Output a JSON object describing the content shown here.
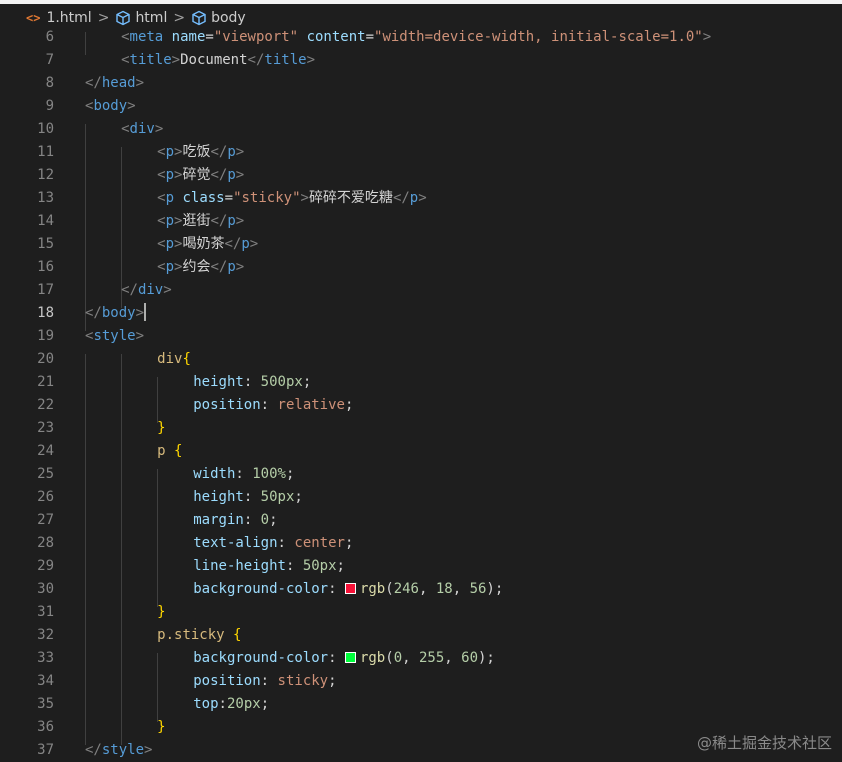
{
  "breadcrumb": {
    "file_icon": "<>",
    "file": "1.html",
    "item1": "html",
    "item2": "body",
    "separator": ">",
    "cube_icon": "symbol-structure-icon"
  },
  "colors": {
    "editor_bg": "#1e1e1e",
    "swatch_red": "rgb(246, 18, 56)",
    "swatch_green": "rgb(0, 255, 60)"
  },
  "editor": {
    "active_line": "18",
    "lines": [
      {
        "n": "6",
        "tokens": [
          [
            "tag-br",
            "<"
          ],
          [
            "tag",
            "meta"
          ],
          [
            "sp",
            " "
          ],
          [
            "attr",
            "name"
          ],
          [
            "punc",
            "="
          ],
          [
            "str",
            "\"viewport\""
          ],
          [
            "sp",
            " "
          ],
          [
            "attr",
            "content"
          ],
          [
            "punc",
            "="
          ],
          [
            "str",
            "\"width=device-width, initial-scale=1.0\""
          ],
          [
            "tag-br",
            ">"
          ]
        ]
      },
      {
        "n": "7",
        "tokens": [
          [
            "tag-br",
            "<"
          ],
          [
            "tag",
            "title"
          ],
          [
            "tag-br",
            ">"
          ],
          [
            "text",
            "Document"
          ],
          [
            "tag-br",
            "</"
          ],
          [
            "tag",
            "title"
          ],
          [
            "tag-br",
            ">"
          ]
        ]
      },
      {
        "n": "8",
        "tokens": [
          [
            "tag-br",
            "</"
          ],
          [
            "tag",
            "head"
          ],
          [
            "tag-br",
            ">"
          ]
        ]
      },
      {
        "n": "9",
        "tokens": [
          [
            "tag-br",
            "<"
          ],
          [
            "tag",
            "body"
          ],
          [
            "tag-br",
            ">"
          ]
        ]
      },
      {
        "n": "10",
        "tokens": [
          [
            "tag-br",
            "<"
          ],
          [
            "tag",
            "div"
          ],
          [
            "tag-br",
            ">"
          ]
        ]
      },
      {
        "n": "11",
        "tokens": [
          [
            "tag-br",
            "<"
          ],
          [
            "tag",
            "p"
          ],
          [
            "tag-br",
            ">"
          ],
          [
            "text",
            "吃饭"
          ],
          [
            "tag-br",
            "</"
          ],
          [
            "tag",
            "p"
          ],
          [
            "tag-br",
            ">"
          ]
        ]
      },
      {
        "n": "12",
        "tokens": [
          [
            "tag-br",
            "<"
          ],
          [
            "tag",
            "p"
          ],
          [
            "tag-br",
            ">"
          ],
          [
            "text",
            "碎觉"
          ],
          [
            "tag-br",
            "</"
          ],
          [
            "tag",
            "p"
          ],
          [
            "tag-br",
            ">"
          ]
        ]
      },
      {
        "n": "13",
        "tokens": [
          [
            "tag-br",
            "<"
          ],
          [
            "tag",
            "p"
          ],
          [
            "sp",
            " "
          ],
          [
            "attr",
            "class"
          ],
          [
            "punc",
            "="
          ],
          [
            "str",
            "\"sticky\""
          ],
          [
            "tag-br",
            ">"
          ],
          [
            "text",
            "碎碎不爱吃糖"
          ],
          [
            "tag-br",
            "</"
          ],
          [
            "tag",
            "p"
          ],
          [
            "tag-br",
            ">"
          ]
        ]
      },
      {
        "n": "14",
        "tokens": [
          [
            "tag-br",
            "<"
          ],
          [
            "tag",
            "p"
          ],
          [
            "tag-br",
            ">"
          ],
          [
            "text",
            "逛街"
          ],
          [
            "tag-br",
            "</"
          ],
          [
            "tag",
            "p"
          ],
          [
            "tag-br",
            ">"
          ]
        ]
      },
      {
        "n": "15",
        "tokens": [
          [
            "tag-br",
            "<"
          ],
          [
            "tag",
            "p"
          ],
          [
            "tag-br",
            ">"
          ],
          [
            "text",
            "喝奶茶"
          ],
          [
            "tag-br",
            "</"
          ],
          [
            "tag",
            "p"
          ],
          [
            "tag-br",
            ">"
          ]
        ]
      },
      {
        "n": "16",
        "tokens": [
          [
            "tag-br",
            "<"
          ],
          [
            "tag",
            "p"
          ],
          [
            "tag-br",
            ">"
          ],
          [
            "text",
            "约会"
          ],
          [
            "tag-br",
            "</"
          ],
          [
            "tag",
            "p"
          ],
          [
            "tag-br",
            ">"
          ]
        ]
      },
      {
        "n": "17",
        "tokens": [
          [
            "tag-br",
            "</"
          ],
          [
            "tag",
            "div"
          ],
          [
            "tag-br",
            ">"
          ]
        ]
      },
      {
        "n": "18",
        "tokens": [
          [
            "tag-br",
            "</"
          ],
          [
            "tag",
            "body"
          ],
          [
            "tag-br",
            ">"
          ],
          [
            "cursor",
            ""
          ]
        ]
      },
      {
        "n": "19",
        "tokens": [
          [
            "tag-br",
            "<"
          ],
          [
            "tag",
            "style"
          ],
          [
            "tag-br",
            ">"
          ]
        ]
      },
      {
        "n": "20",
        "tokens": [
          [
            "sel",
            "div"
          ],
          [
            "brace",
            "{"
          ]
        ]
      },
      {
        "n": "21",
        "tokens": [
          [
            "prop",
            "height"
          ],
          [
            "punc",
            ": "
          ],
          [
            "num",
            "500px"
          ],
          [
            "punc",
            ";"
          ]
        ]
      },
      {
        "n": "22",
        "tokens": [
          [
            "prop",
            "position"
          ],
          [
            "punc",
            ": "
          ],
          [
            "val",
            "relative"
          ],
          [
            "punc",
            ";"
          ]
        ]
      },
      {
        "n": "23",
        "tokens": [
          [
            "brace",
            "}"
          ]
        ]
      },
      {
        "n": "24",
        "tokens": [
          [
            "sel",
            "p"
          ],
          [
            "sp",
            " "
          ],
          [
            "brace",
            "{"
          ]
        ]
      },
      {
        "n": "25",
        "tokens": [
          [
            "prop",
            "width"
          ],
          [
            "punc",
            ": "
          ],
          [
            "num",
            "100%"
          ],
          [
            "punc",
            ";"
          ]
        ]
      },
      {
        "n": "26",
        "tokens": [
          [
            "prop",
            "height"
          ],
          [
            "punc",
            ": "
          ],
          [
            "num",
            "50px"
          ],
          [
            "punc",
            ";"
          ]
        ]
      },
      {
        "n": "27",
        "tokens": [
          [
            "prop",
            "margin"
          ],
          [
            "punc",
            ": "
          ],
          [
            "num",
            "0"
          ],
          [
            "punc",
            ";"
          ]
        ]
      },
      {
        "n": "28",
        "tokens": [
          [
            "prop",
            "text-align"
          ],
          [
            "punc",
            ": "
          ],
          [
            "val",
            "center"
          ],
          [
            "punc",
            ";"
          ]
        ]
      },
      {
        "n": "29",
        "tokens": [
          [
            "prop",
            "line-height"
          ],
          [
            "punc",
            ": "
          ],
          [
            "num",
            "50px"
          ],
          [
            "punc",
            ";"
          ]
        ]
      },
      {
        "n": "30",
        "tokens": [
          [
            "prop",
            "background-color"
          ],
          [
            "punc",
            ": "
          ],
          [
            "swatch",
            "#f61238"
          ],
          [
            "fn",
            "rgb"
          ],
          [
            "punc",
            "("
          ],
          [
            "num",
            "246"
          ],
          [
            "punc",
            ", "
          ],
          [
            "num",
            "18"
          ],
          [
            "punc",
            ", "
          ],
          [
            "num",
            "56"
          ],
          [
            "punc",
            ");"
          ]
        ]
      },
      {
        "n": "31",
        "tokens": [
          [
            "brace",
            "}"
          ]
        ]
      },
      {
        "n": "32",
        "tokens": [
          [
            "sel",
            "p.sticky"
          ],
          [
            "sp",
            " "
          ],
          [
            "brace",
            "{"
          ]
        ]
      },
      {
        "n": "33",
        "tokens": [
          [
            "prop",
            "background-color"
          ],
          [
            "punc",
            ": "
          ],
          [
            "swatch",
            "#00ff3c"
          ],
          [
            "fn",
            "rgb"
          ],
          [
            "punc",
            "("
          ],
          [
            "num",
            "0"
          ],
          [
            "punc",
            ", "
          ],
          [
            "num",
            "255"
          ],
          [
            "punc",
            ", "
          ],
          [
            "num",
            "60"
          ],
          [
            "punc",
            ");"
          ]
        ]
      },
      {
        "n": "34",
        "tokens": [
          [
            "prop",
            "position"
          ],
          [
            "punc",
            ": "
          ],
          [
            "val",
            "sticky"
          ],
          [
            "punc",
            ";"
          ]
        ]
      },
      {
        "n": "35",
        "tokens": [
          [
            "prop",
            "top"
          ],
          [
            "punc",
            ":"
          ],
          [
            "num",
            "20px"
          ],
          [
            "punc",
            ";"
          ]
        ]
      },
      {
        "n": "36",
        "tokens": [
          [
            "brace",
            "}"
          ]
        ]
      },
      {
        "n": "37",
        "tokens": [
          [
            "tag-br",
            "</"
          ],
          [
            "tag",
            "style"
          ],
          [
            "tag-br",
            ">"
          ]
        ]
      }
    ]
  },
  "watermark": "@稀土掘金技术社区"
}
